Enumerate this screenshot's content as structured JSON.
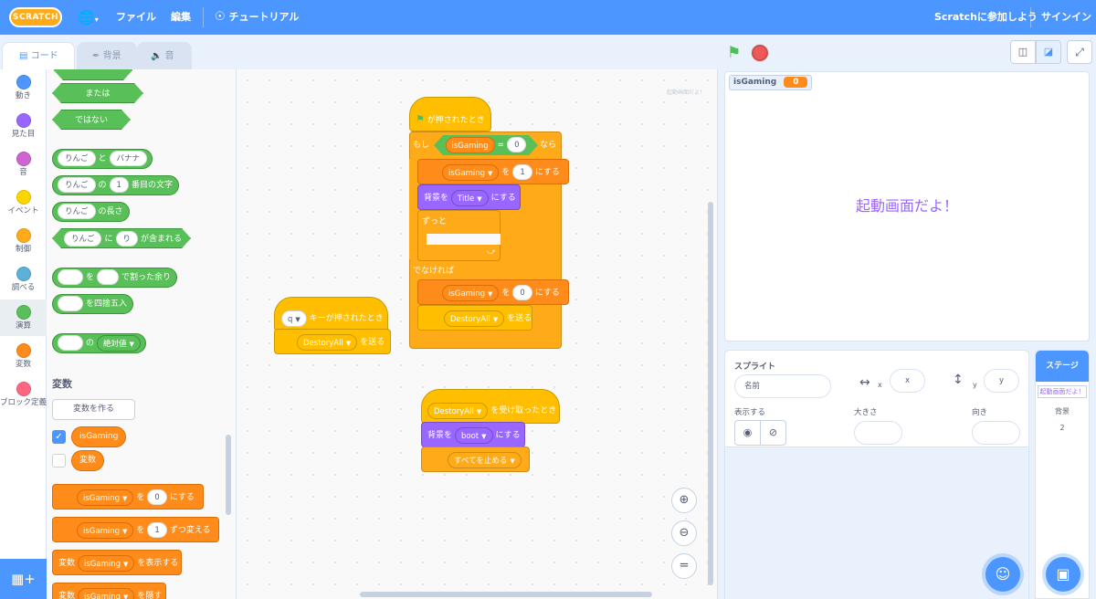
{
  "menu": {
    "logo": "SCRATCH",
    "file": "ファイル",
    "edit": "編集",
    "tutorial": "チュートリアル",
    "join": "Scratchに参加しよう",
    "signin": "サインイン"
  },
  "tabs": {
    "code": "コード",
    "backdrop": "背景",
    "sound": "音"
  },
  "categories": [
    {
      "label": "動き",
      "color": "#4c97ff"
    },
    {
      "label": "見た目",
      "color": "#9966ff"
    },
    {
      "label": "音",
      "color": "#cf63cf"
    },
    {
      "label": "イベント",
      "color": "#ffd500"
    },
    {
      "label": "制御",
      "color": "#ffab19"
    },
    {
      "label": "調べる",
      "color": "#5cb1d6"
    },
    {
      "label": "演算",
      "color": "#59c059"
    },
    {
      "label": "変数",
      "color": "#ff8c1a"
    },
    {
      "label": "ブロック定義",
      "color": "#ff6680"
    }
  ],
  "palette": {
    "or": "または",
    "not": "ではない",
    "join_a": "りんご",
    "join_and": "と",
    "join_b": "バナナ",
    "letter_of_str": "りんご",
    "letter_of": "の",
    "letter_num": "1",
    "letter_suffix": "番目の文字",
    "length_str": "りんご",
    "length_of": "の長さ",
    "contains_str": "りんご",
    "contains_mid": "に",
    "contains_b": "り",
    "contains_suffix": "が含まれる",
    "mod_a": "を",
    "mod_suffix": "で割った余り",
    "round": "を四捨五入",
    "abs_of": "の",
    "abs_op": "絶対値",
    "section_variables": "変数",
    "make_variable": "変数を作る",
    "var1": "isGaming",
    "var2": "変数",
    "set_var": "isGaming",
    "set_mid": "を",
    "set_val": "0",
    "set_suffix": "にする",
    "change_var": "isGaming",
    "change_mid": "を",
    "change_val": "1",
    "change_suffix": "ずつ変える",
    "show_prefix": "変数",
    "show_var": "isGaming",
    "show_suffix": "を表示する",
    "hide_prefix": "変数",
    "hide_var": "isGaming",
    "hide_suffix": "を隠す"
  },
  "script1": {
    "hat": "が押されたとき",
    "if": "もし",
    "cond_var": "isGaming",
    "cond_eq": "=",
    "cond_val": "0",
    "then": "なら",
    "set1_var": "isGaming",
    "set1_mid": "を",
    "set1_val": "1",
    "set1_suffix": "にする",
    "bg_prefix": "背景を",
    "bg_val": "Title",
    "bg_suffix": "にする",
    "forever": "ずっと",
    "else": "でなければ",
    "set2_var": "isGaming",
    "set2_mid": "を",
    "set2_val": "0",
    "set2_suffix": "にする",
    "bcast_val": "DestoryAll",
    "bcast_suffix": "を送る"
  },
  "script2": {
    "key": "q",
    "hat_suffix": "キーが押されたとき",
    "bcast_val": "DestoryAll",
    "bcast_suffix": "を送る"
  },
  "script3": {
    "msg": "DestoryAll",
    "hat_suffix": "を受け取ったとき",
    "bg_prefix": "背景を",
    "bg_val": "boot",
    "bg_suffix": "にする",
    "stop": "すべてを止める"
  },
  "workspace": {
    "thumb_label": "起動画面だよ！"
  },
  "stage": {
    "monitor_name": "isGaming",
    "monitor_value": "0",
    "text": "起動画面だよ！",
    "text_color": "#9966ff"
  },
  "sprite_info": {
    "sprite_label": "スプライト",
    "name_placeholder": "名前",
    "x_label": "x",
    "x_placeholder": "x",
    "y_label": "y",
    "y_placeholder": "y",
    "show_label": "表示する",
    "size_label": "大きさ",
    "direction_label": "向き"
  },
  "stage_panel": {
    "title": "ステージ",
    "thumb_text": "起動画面だよ！",
    "backdrops_label": "背景",
    "backdrops_count": "2"
  }
}
